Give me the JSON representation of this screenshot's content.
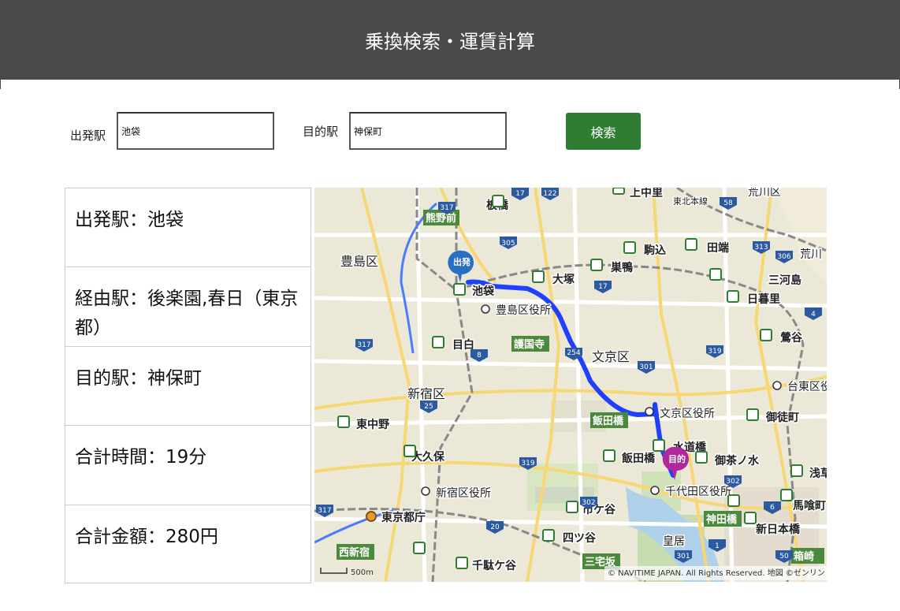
{
  "header": {
    "title": "乗換検索・運賃計算"
  },
  "form": {
    "from_label": "出発駅",
    "from_value": "池袋",
    "to_label": "目的駅",
    "to_value": "神保町",
    "search_button": "検索"
  },
  "result": {
    "rows": [
      {
        "text": "出発駅：池袋"
      },
      {
        "text": "経由駅：後楽園,春日（東京都）"
      },
      {
        "text": "目的駅：神保町"
      },
      {
        "text": "合計時間：19分"
      },
      {
        "text": "合計金額：280円"
      }
    ]
  },
  "map": {
    "start_pin": "出発",
    "end_pin": "目的",
    "scale": "500m",
    "copyright": "© NAVITIME JAPAN. All Rights Reserved. 地図 ©ゼンリン",
    "places": {
      "kumano": "熊野前",
      "itabashi": "板橋",
      "kamonakazato": "上中里",
      "higashikita": "東北本線",
      "arakawaku": "荒川区",
      "toshimaku": "豊島区",
      "ikebukuro": "池袋",
      "otsuka": "大塚",
      "sugamo": "巣鴨",
      "komagome": "駒込",
      "tabata": "田端",
      "arakawa": "荒川",
      "mikawashima": "三河島",
      "nippori": "日暮里",
      "uguisudani": "鶯谷",
      "toshima_office": "豊島区役所",
      "gokokuji": "護国寺",
      "mejiro": "目白",
      "bunkyoku": "文京区",
      "taito_office": "台東区役",
      "shinjukuku": "新宿区",
      "bunkyo_office": "文京区役所",
      "okachimachi": "御徒町",
      "higashinakano": "東中野",
      "iidabashi_green": "飯田橋",
      "iidabashi": "飯田橋",
      "suidobashi": "水道橋",
      "ochanomizu": "御茶ノ水",
      "okubo": "大久保",
      "asakusa": "浅草",
      "shinjuku_office": "新宿区役所",
      "chiyoda_office": "千代田区役所",
      "bakurocho": "馬喰町",
      "tocho": "東京都庁",
      "ichigaya": "市ケ谷",
      "kanda": "神田橋",
      "shinnihonbashi": "新日本橋",
      "nishishinjuku": "西新宿",
      "yotsuya": "四ツ谷",
      "kokyo": "皇居",
      "hakozaki": "箱崎",
      "sendagaya": "千駄ケ谷",
      "sanzaka": "三宅坂"
    }
  }
}
